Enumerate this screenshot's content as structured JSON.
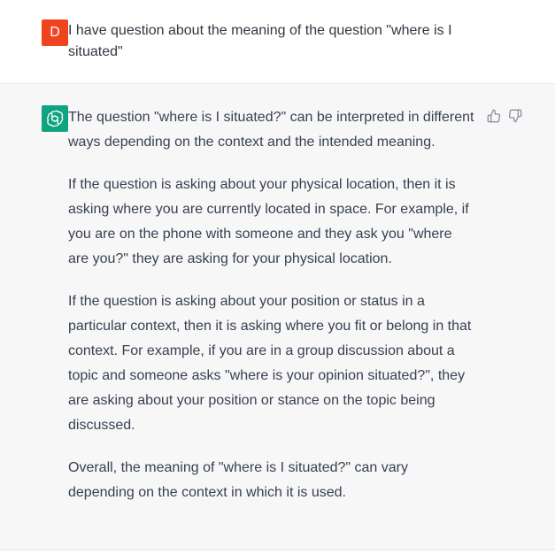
{
  "user_message": {
    "avatar_letter": "D",
    "text": "I have question about the meaning of the question \"where is I situated\""
  },
  "assistant_message": {
    "paragraphs": [
      "The question \"where is I situated?\" can be interpreted in different ways depending on the context and the intended meaning.",
      "If the question is asking about your physical location, then it is asking where you are currently located in space. For example, if you are on the phone with someone and they ask you \"where are you?\" they are asking for your physical location.",
      "If the question is asking about your position or status in a particular context, then it is asking where you fit or belong in that context. For example, if you are in a group discussion about a topic and someone asks \"where is your opinion situated?\", they are asking about your position or stance on the topic being discussed.",
      "Overall, the meaning of \"where is I situated?\" can vary depending on the context in which it is used."
    ]
  },
  "colors": {
    "user_avatar": "#f0441f",
    "assistant_avatar": "#10a37f",
    "assistant_background": "#f7f7f8"
  },
  "icons": {
    "assistant_avatar": "openai-logo-icon",
    "feedback_up": "thumbs-up-icon",
    "feedback_down": "thumbs-down-icon"
  }
}
